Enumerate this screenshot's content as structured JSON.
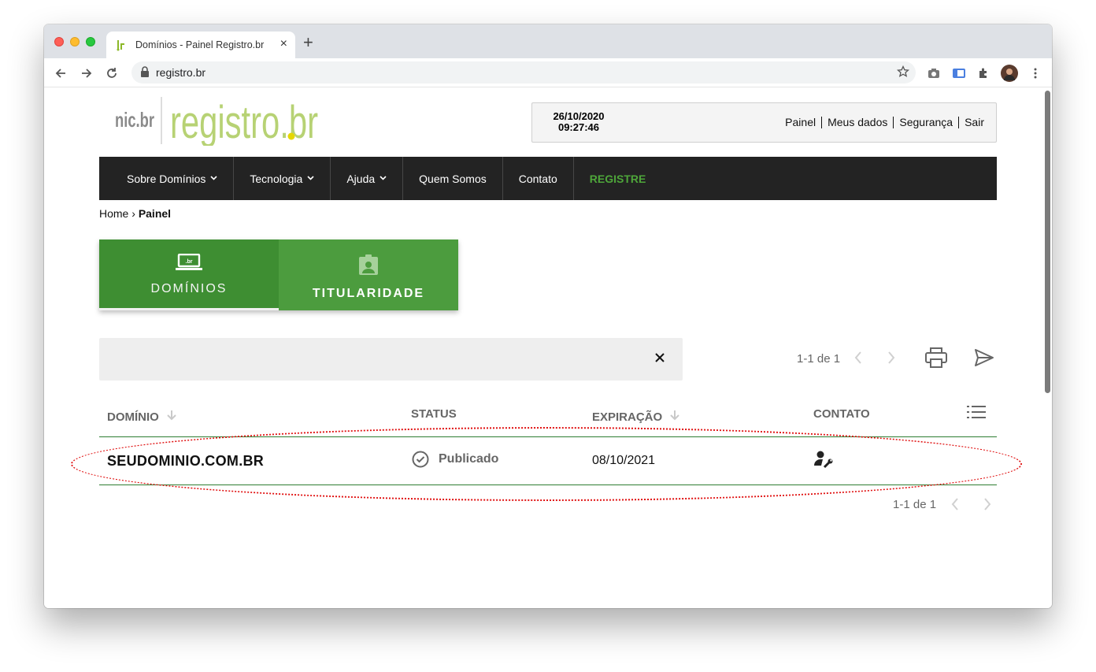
{
  "browser": {
    "tab_title": "Domínios - Painel Registro.br",
    "url": "registro.br",
    "favicon": ".br"
  },
  "header": {
    "logo_left": "nic.br",
    "logo_right": "registro.br",
    "date": "26/10/2020",
    "time": "09:27:46",
    "links": [
      "Painel",
      "Meus dados",
      "Segurança",
      "Sair"
    ]
  },
  "menu": {
    "items": [
      "Sobre Domínios",
      "Tecnologia",
      "Ajuda",
      "Quem Somos",
      "Contato",
      "REGISTRE"
    ],
    "register_color": "#4ea63a"
  },
  "breadcrumb": {
    "home": "Home",
    "separator": "›",
    "current": "Painel"
  },
  "tiles": [
    {
      "label": "DOMÍNIOS",
      "icon": "laptop-br-icon",
      "active": true
    },
    {
      "label": "TITULARIDADE",
      "icon": "badge-icon",
      "active": false
    }
  ],
  "search": {
    "value": "",
    "clear_icon": "close-icon"
  },
  "pagination_top": {
    "text": "1-1 de 1"
  },
  "pagination_bottom": {
    "text": "1-1 de 1"
  },
  "table": {
    "headers": {
      "domain": "DOMÍNIO",
      "status": "STATUS",
      "expiration": "EXPIRAÇÃO",
      "contact": "CONTATO"
    },
    "rows": [
      {
        "domain": "SEUDOMINIO.COM.BR",
        "status": "Publicado",
        "expiration": "08/10/2021",
        "contact_icon": "contact-settings-icon"
      }
    ]
  },
  "colors": {
    "brand_green": "#3e8e32",
    "tile_green": "#4c9c3e",
    "menu_bg": "#232323",
    "highlight": "#e01010"
  }
}
